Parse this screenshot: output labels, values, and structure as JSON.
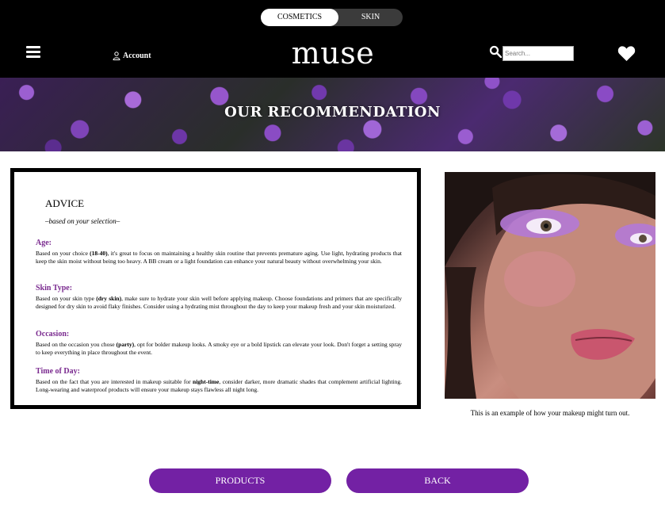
{
  "toggle": {
    "active_label": "COSMETICS",
    "inactive_label": "SKIN"
  },
  "header": {
    "account_label": "Account",
    "logo_text": "muse",
    "search_placeholder": "Search..."
  },
  "banner": {
    "title": "OUR RECOMMENDATION"
  },
  "advice": {
    "title": "ADVICE",
    "subtitle": "–based on your selection–",
    "sections": [
      {
        "heading": "Age:",
        "text_before": "Based on your choice ",
        "highlight": "(18-40)",
        "text_after": ", it's great to focus on maintaining a healthy skin routine that prevents premature aging. Use light, hydrating products that keep the skin moist without being too heavy. A BB cream or a light foundation can enhance your natural beauty without overwhelming your skin."
      },
      {
        "heading": "Skin Type:",
        "text_before": "Based on your skin type ",
        "highlight": "(dry skin)",
        "text_after": ", make sure to hydrate your skin well before applying makeup. Choose foundations and primers that are specifically designed for dry skin to avoid flaky finishes. Consider using a hydrating mist throughout the day to keep your makeup fresh and your skin moisturized."
      },
      {
        "heading": "Occasion:",
        "text_before": "Based on the occasion you chose ",
        "highlight": "(party)",
        "text_after": ", opt for bolder makeup looks. A smoky eye or a bold lipstick can elevate your look. Don't forget a setting spray to keep everything in place throughout the event."
      },
      {
        "heading": "Time of Day:",
        "text_before": "Based on the fact that you are interested in makeup suitable for ",
        "highlight": "night-time",
        "text_after": ", consider darker, more dramatic shades that complement artificial lighting. Long-wearing and waterproof products will ensure your makeup stays flawless all night long."
      }
    ]
  },
  "photo": {
    "caption": "This is an example of how your makeup might turn out."
  },
  "buttons": {
    "products": "PRODUCTS",
    "back": "BACK"
  },
  "colors": {
    "accent": "#7321a4",
    "heading": "#7a2a8f",
    "header_bg": "#000000"
  }
}
